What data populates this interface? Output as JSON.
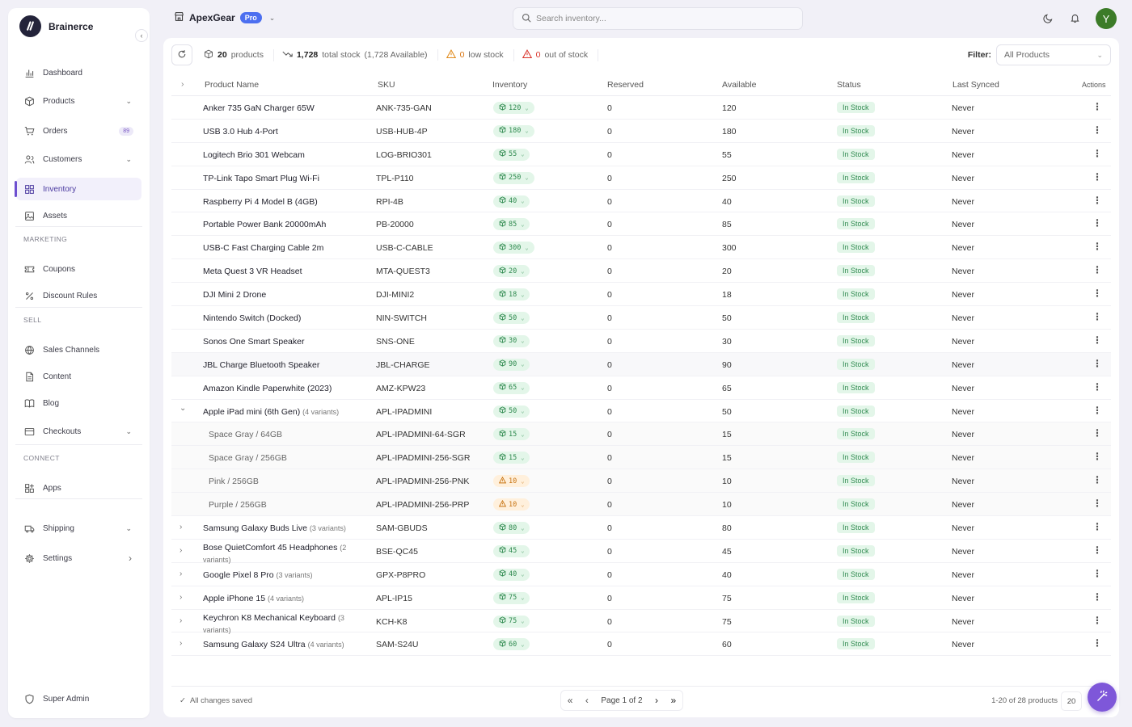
{
  "brand": {
    "name": "Brainerce"
  },
  "sidebar": {
    "items": [
      {
        "label": "Dashboard",
        "icon": "chart-icon"
      },
      {
        "label": "Products",
        "icon": "box-icon",
        "chevron": true
      },
      {
        "label": "Orders",
        "icon": "cart-icon",
        "badge": "89"
      },
      {
        "label": "Customers",
        "icon": "users-icon",
        "chevron": true
      },
      {
        "label": "Inventory",
        "icon": "grid-icon",
        "active": true
      },
      {
        "label": "Assets",
        "icon": "image-icon"
      },
      {
        "label": "Coupons",
        "icon": "ticket-icon"
      },
      {
        "label": "Discount Rules",
        "icon": "percent-icon"
      },
      {
        "label": "Sales Channels",
        "icon": "globe-icon"
      },
      {
        "label": "Content",
        "icon": "document-icon"
      },
      {
        "label": "Blog",
        "icon": "book-icon"
      },
      {
        "label": "Checkouts",
        "icon": "card-icon",
        "chevron": true
      },
      {
        "label": "Apps",
        "icon": "apps-icon"
      },
      {
        "label": "Shipping",
        "icon": "truck-icon",
        "chevron": true
      },
      {
        "label": "Settings",
        "icon": "gear-icon",
        "chevron_right": true
      }
    ],
    "sections": {
      "marketing": "MARKETING",
      "sell": "SELL",
      "connect": "CONNECT"
    },
    "footer_label": "Super Admin"
  },
  "header": {
    "store_name": "ApexGear",
    "plan_badge": "Pro",
    "search_placeholder": "Search inventory...",
    "avatar_initial": "Y"
  },
  "stats": {
    "products_count": "20",
    "products_label": "products",
    "total_stock": "1,728",
    "total_stock_label": "total stock",
    "available_note": "(1,728 Available)",
    "low_stock_count": "0",
    "low_stock_label": "low stock",
    "out_of_stock_count": "0",
    "out_of_stock_label": "out of stock"
  },
  "filter": {
    "label": "Filter:",
    "value": "All Products"
  },
  "table": {
    "headers": {
      "name": "Product Name",
      "sku": "SKU",
      "inventory": "Inventory",
      "reserved": "Reserved",
      "available": "Available",
      "status": "Status",
      "last_synced": "Last Synced",
      "actions": "Actions"
    },
    "rows": [
      {
        "name": "Anker 735 GaN Charger 65W",
        "sku": "ANK-735-GAN",
        "inventory": "120",
        "reserved": "0",
        "available": "120",
        "status": "In Stock",
        "synced": "Never"
      },
      {
        "name": "USB 3.0 Hub 4-Port",
        "sku": "USB-HUB-4P",
        "inventory": "180",
        "reserved": "0",
        "available": "180",
        "status": "In Stock",
        "synced": "Never"
      },
      {
        "name": "Logitech Brio 301 Webcam",
        "sku": "LOG-BRIO301",
        "inventory": "55",
        "reserved": "0",
        "available": "55",
        "status": "In Stock",
        "synced": "Never"
      },
      {
        "name": "TP-Link Tapo Smart Plug Wi-Fi",
        "sku": "TPL-P110",
        "inventory": "250",
        "reserved": "0",
        "available": "250",
        "status": "In Stock",
        "synced": "Never"
      },
      {
        "name": "Raspberry Pi 4 Model B (4GB)",
        "sku": "RPI-4B",
        "inventory": "40",
        "reserved": "0",
        "available": "40",
        "status": "In Stock",
        "synced": "Never"
      },
      {
        "name": "Portable Power Bank 20000mAh",
        "sku": "PB-20000",
        "inventory": "85",
        "reserved": "0",
        "available": "85",
        "status": "In Stock",
        "synced": "Never"
      },
      {
        "name": "USB-C Fast Charging Cable 2m",
        "sku": "USB-C-CABLE",
        "inventory": "300",
        "reserved": "0",
        "available": "300",
        "status": "In Stock",
        "synced": "Never"
      },
      {
        "name": "Meta Quest 3 VR Headset",
        "sku": "MTA-QUEST3",
        "inventory": "20",
        "reserved": "0",
        "available": "20",
        "status": "In Stock",
        "synced": "Never"
      },
      {
        "name": "DJI Mini 2 Drone",
        "sku": "DJI-MINI2",
        "inventory": "18",
        "reserved": "0",
        "available": "18",
        "status": "In Stock",
        "synced": "Never"
      },
      {
        "name": "Nintendo Switch (Docked)",
        "sku": "NIN-SWITCH",
        "inventory": "50",
        "reserved": "0",
        "available": "50",
        "status": "In Stock",
        "synced": "Never"
      },
      {
        "name": "Sonos One Smart Speaker",
        "sku": "SNS-ONE",
        "inventory": "30",
        "reserved": "0",
        "available": "30",
        "status": "In Stock",
        "synced": "Never"
      },
      {
        "name": "JBL Charge Bluetooth Speaker",
        "sku": "JBL-CHARGE",
        "inventory": "90",
        "reserved": "0",
        "available": "90",
        "status": "In Stock",
        "synced": "Never",
        "highlight": true
      },
      {
        "name": "Amazon Kindle Paperwhite (2023)",
        "sku": "AMZ-KPW23",
        "inventory": "65",
        "reserved": "0",
        "available": "65",
        "status": "In Stock",
        "synced": "Never"
      },
      {
        "name": "Apple iPad mini (6th Gen)",
        "variants": "(4 variants)",
        "expanded": true,
        "sku": "APL-IPADMINI",
        "inventory": "50",
        "reserved": "0",
        "available": "50",
        "status": "In Stock",
        "synced": "Never"
      },
      {
        "name": "Space Gray / 64GB",
        "variant": true,
        "sku": "APL-IPADMINI-64-SGR",
        "inventory": "15",
        "reserved": "0",
        "available": "15",
        "status": "In Stock",
        "synced": "Never"
      },
      {
        "name": "Space Gray / 256GB",
        "variant": true,
        "sku": "APL-IPADMINI-256-SGR",
        "inventory": "15",
        "reserved": "0",
        "available": "15",
        "status": "In Stock",
        "synced": "Never"
      },
      {
        "name": "Pink / 256GB",
        "variant": true,
        "low": true,
        "sku": "APL-IPADMINI-256-PNK",
        "inventory": "10",
        "reserved": "0",
        "available": "10",
        "status": "In Stock",
        "synced": "Never"
      },
      {
        "name": "Purple / 256GB",
        "variant": true,
        "low": true,
        "sku": "APL-IPADMINI-256-PRP",
        "inventory": "10",
        "reserved": "0",
        "available": "10",
        "status": "In Stock",
        "synced": "Never"
      },
      {
        "name": "Samsung Galaxy Buds Live",
        "variants": "(3 variants)",
        "sku": "SAM-GBUDS",
        "inventory": "80",
        "reserved": "0",
        "available": "80",
        "status": "In Stock",
        "synced": "Never"
      },
      {
        "name": "Bose QuietComfort 45 Headphones",
        "variants": "(2 variants)",
        "two_line": true,
        "sku": "BSE-QC45",
        "inventory": "45",
        "reserved": "0",
        "available": "45",
        "status": "In Stock",
        "synced": "Never"
      },
      {
        "name": "Google Pixel 8 Pro",
        "variants": "(3 variants)",
        "sku": "GPX-P8PRO",
        "inventory": "40",
        "reserved": "0",
        "available": "40",
        "status": "In Stock",
        "synced": "Never"
      },
      {
        "name": "Apple iPhone 15",
        "variants": "(4 variants)",
        "sku": "APL-IP15",
        "inventory": "75",
        "reserved": "0",
        "available": "75",
        "status": "In Stock",
        "synced": "Never"
      },
      {
        "name": "Keychron K8 Mechanical Keyboard",
        "variants": "(3 variants)",
        "two_line": true,
        "sku": "KCH-K8",
        "inventory": "75",
        "reserved": "0",
        "available": "75",
        "status": "In Stock",
        "synced": "Never"
      },
      {
        "name": "Samsung Galaxy S24 Ultra",
        "variants": "(4 variants)",
        "sku": "SAM-S24U",
        "inventory": "60",
        "reserved": "0",
        "available": "60",
        "status": "In Stock",
        "synced": "Never"
      }
    ]
  },
  "footer": {
    "saved_text": "All changes saved",
    "page_text": "Page 1 of 2",
    "count_text": "1-20 of 28 products",
    "per_page": "20"
  },
  "colors": {
    "accent": "#6d4fd0",
    "in_stock_bg": "#e3f6e9",
    "in_stock_text": "#2f8a4f",
    "low_bg": "#fff0dc",
    "low_text": "#c87310",
    "pro_badge": "#4c6ff0",
    "avatar": "#3c7b28"
  }
}
